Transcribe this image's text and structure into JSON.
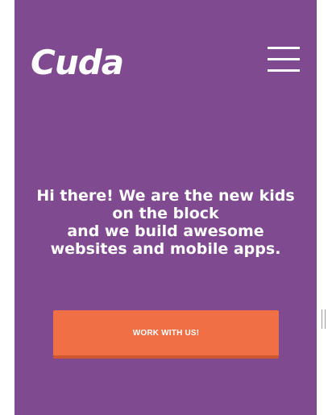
{
  "brand": {
    "logo_text": "Cuda"
  },
  "header": {
    "menu_icon": "hamburger-menu-icon"
  },
  "hero": {
    "line1": "Hi there! We are the new kids on the block",
    "line2": "and we build awesome websites and mobile apps."
  },
  "cta": {
    "label": "WORK WITH US!"
  },
  "colors": {
    "background": "#7f4a8f",
    "accent": "#f06f45",
    "text": "#ffffff"
  }
}
